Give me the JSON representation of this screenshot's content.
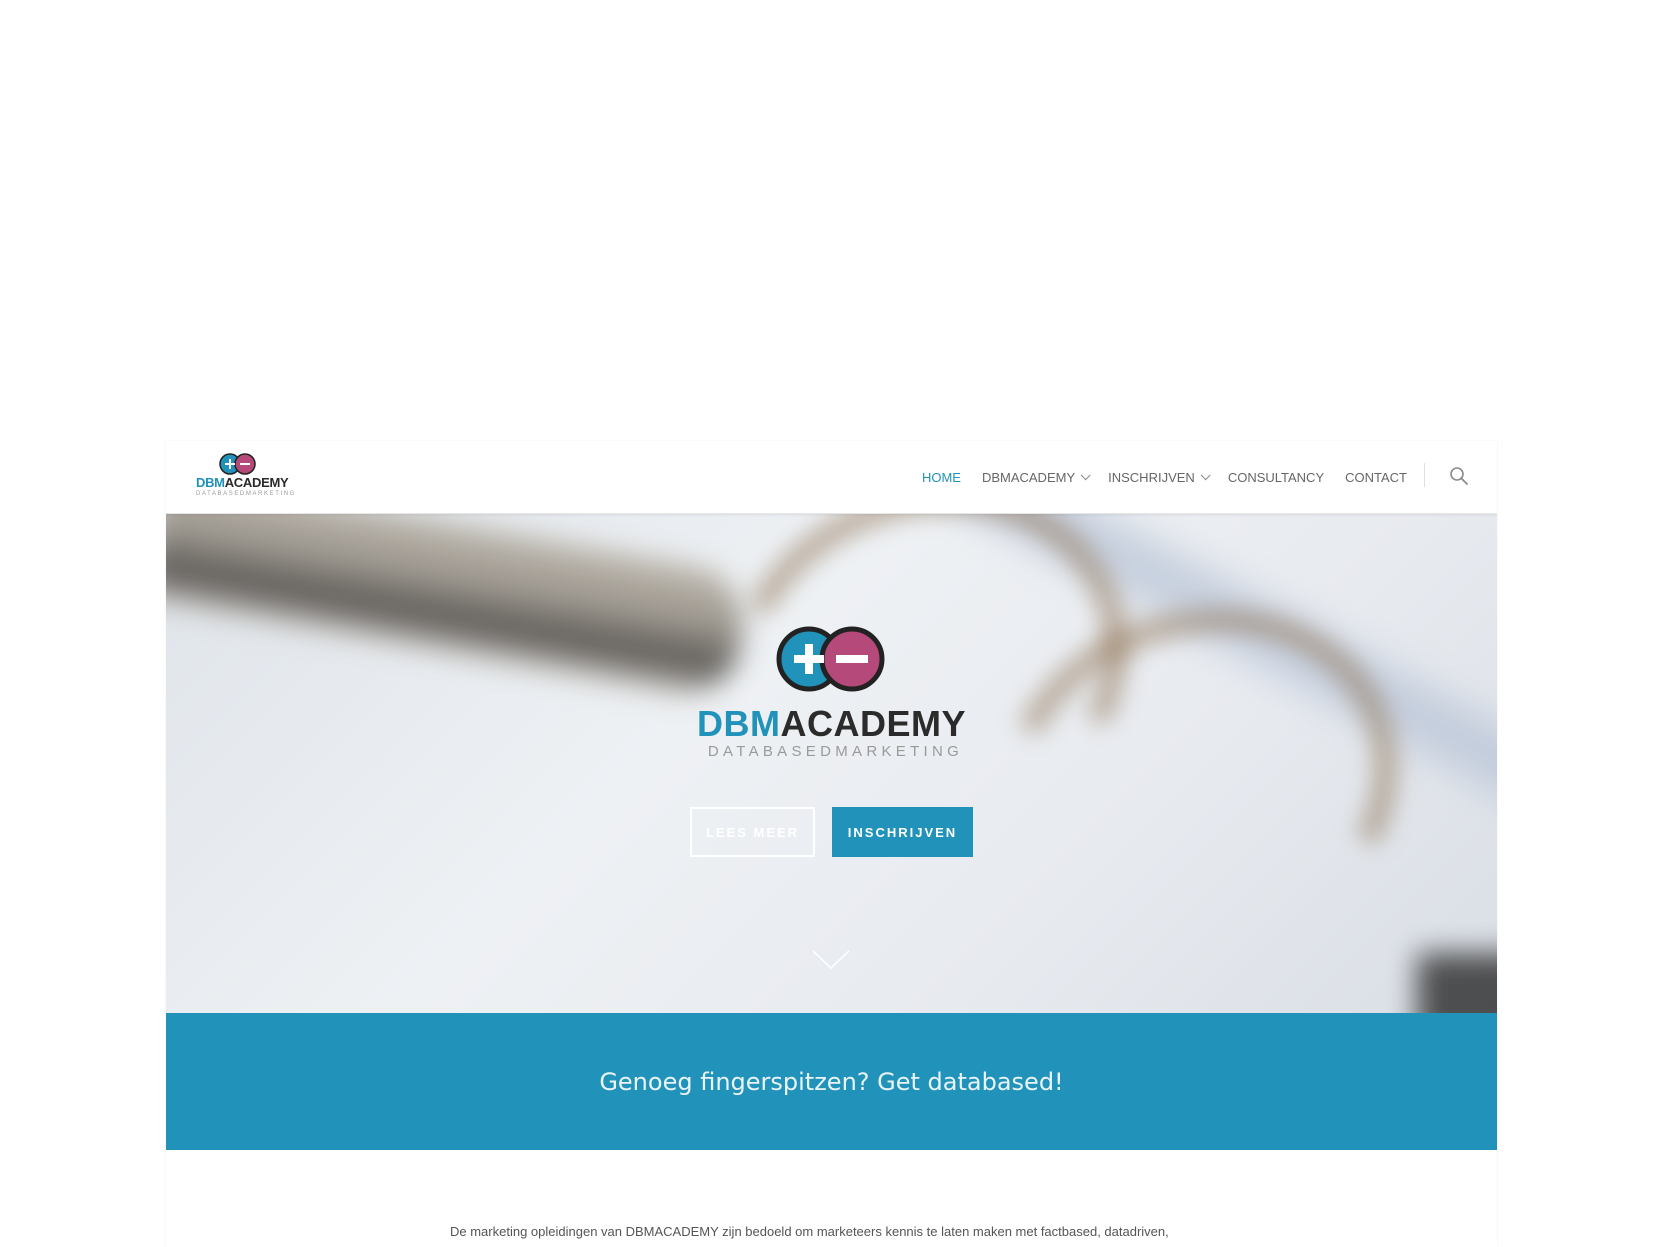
{
  "brand": {
    "name_prefix": "DBM",
    "name_suffix": "ACADEMY",
    "tagline": "DATABASEDMARKETING",
    "colors": {
      "accent": "#2192b9",
      "secondary": "#b5497a",
      "dark": "#2b2b2b"
    }
  },
  "nav": {
    "items": [
      {
        "label": "HOME",
        "active": true,
        "dropdown": false
      },
      {
        "label": "DBMACADEMY",
        "active": false,
        "dropdown": true
      },
      {
        "label": "INSCHRIJVEN",
        "active": false,
        "dropdown": true
      },
      {
        "label": "CONSULTANCY",
        "active": false,
        "dropdown": false
      },
      {
        "label": "CONTACT",
        "active": false,
        "dropdown": false
      }
    ],
    "search_icon": "search-icon"
  },
  "hero": {
    "buttons": {
      "primary_outline": "LEES MEER",
      "primary_solid": "INSCHRIJVEN"
    },
    "scroll_icon": "chevron-down-icon"
  },
  "banner": {
    "text": "Genoeg fingerspitzen? Get databased!"
  },
  "content": {
    "intro": "De marketing opleidingen van DBMACADEMY zijn bedoeld om marketeers kennis te laten maken met factbased, datadriven,"
  }
}
